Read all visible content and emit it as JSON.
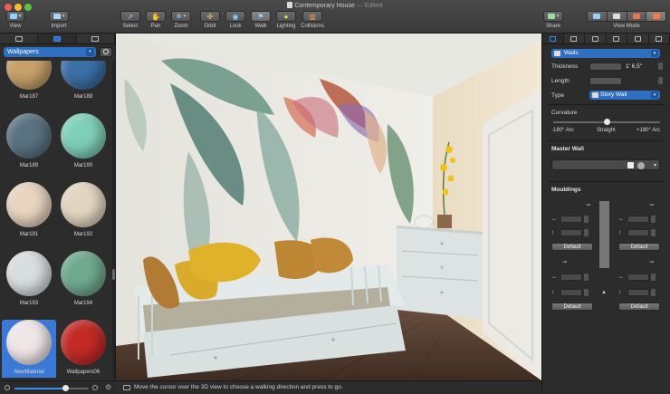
{
  "window": {
    "title": "Contemporary House",
    "edited": "— Edited"
  },
  "toolbar": {
    "view": "View",
    "import": "Import",
    "select": "Select",
    "pan": "Pan",
    "zoom": "Zoom",
    "orbit": "Orbit",
    "look": "Look",
    "walk": "Walk",
    "lighting": "Lighting",
    "collisions": "Collisions",
    "share": "Share",
    "view_mode": "View Mode"
  },
  "library": {
    "category": "Wallpapers",
    "items": [
      {
        "name": "Mar187",
        "color": "#c7a06a"
      },
      {
        "name": "Mar188",
        "color": "#3b6fa6"
      },
      {
        "name": "Mar189",
        "color": "#5a7282"
      },
      {
        "name": "Mar190",
        "color": "#7fcfb8"
      },
      {
        "name": "Mar191",
        "color": "#e8d4bf"
      },
      {
        "name": "Mar192",
        "color": "#e3d6c0"
      },
      {
        "name": "Mar193",
        "color": "#d8dde0"
      },
      {
        "name": "Mar194",
        "color": "#6fa98e"
      },
      {
        "name": "NewMaterial",
        "color": "#f0e6e8"
      },
      {
        "name": "Wallpapers06",
        "color": "#c22a26"
      }
    ],
    "selected_index": 8,
    "zoom_level": 0.68
  },
  "status": {
    "message": "Move the cursor over the 3D view to choose a walking direction and press to go."
  },
  "inspector": {
    "object": "Walls",
    "thickness_label": "Thickness",
    "thickness_value": "1' 6,5\"",
    "length_label": "Length",
    "type_label": "Type",
    "type_value": "Story Wall",
    "curvature_label": "Curvature",
    "curv_min": "-180° Arc",
    "curv_mid": "Straight",
    "curv_max": "+180° Arc",
    "master_wall": "Master Wall",
    "mouldings": "Mouldings",
    "default_label": "Default"
  }
}
